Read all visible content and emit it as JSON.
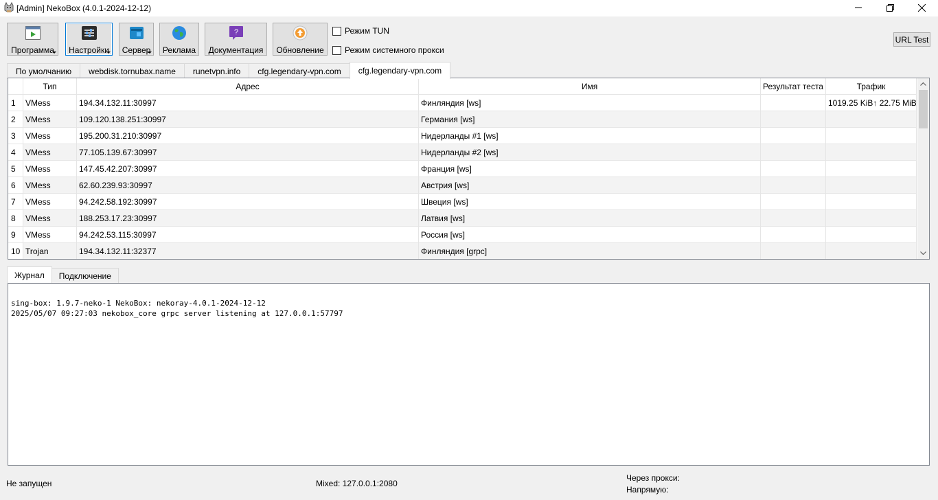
{
  "window": {
    "title": "[Admin] NekoBox (4.0.1-2024-12-12)"
  },
  "toolbar": {
    "buttons": [
      {
        "label": "Программа",
        "icon": "program-icon"
      },
      {
        "label": "Настройки",
        "icon": "settings-sliders-icon"
      },
      {
        "label": "Сервер",
        "icon": "server-icon"
      },
      {
        "label": "Реклама",
        "icon": "globe-icon"
      },
      {
        "label": "Документация",
        "icon": "help-doc-icon"
      },
      {
        "label": "Обновление",
        "icon": "update-icon"
      }
    ],
    "tun_mode": {
      "label": "Режим TUN",
      "checked": false
    },
    "system_proxy": {
      "label": "Режим системного прокси",
      "checked": false
    },
    "url_test": "URL Test"
  },
  "groups": {
    "tabs": [
      "По умолчанию",
      "webdisk.tornubax.name",
      "runetvpn.info",
      "cfg.legendary-vpn.com",
      "cfg.legendary-vpn.com"
    ],
    "active_index": 4
  },
  "table": {
    "headers": [
      "Тип",
      "Адрес",
      "Имя",
      "Результат теста",
      "Трафик"
    ],
    "rows": [
      {
        "n": "1",
        "type": "VMess",
        "address": "194.34.132.11:30997",
        "name": "Финляндия [ws]",
        "result": "",
        "traffic": "1019.25 KiB↑ 22.75 MiB↓"
      },
      {
        "n": "2",
        "type": "VMess",
        "address": "109.120.138.251:30997",
        "name": "Германия [ws]",
        "result": "",
        "traffic": ""
      },
      {
        "n": "3",
        "type": "VMess",
        "address": "195.200.31.210:30997",
        "name": "Нидерланды #1 [ws]",
        "result": "",
        "traffic": ""
      },
      {
        "n": "4",
        "type": "VMess",
        "address": "77.105.139.67:30997",
        "name": "Нидерланды #2 [ws]",
        "result": "",
        "traffic": ""
      },
      {
        "n": "5",
        "type": "VMess",
        "address": "147.45.42.207:30997",
        "name": "Франция [ws]",
        "result": "",
        "traffic": ""
      },
      {
        "n": "6",
        "type": "VMess",
        "address": "62.60.239.93:30997",
        "name": "Австрия [ws]",
        "result": "",
        "traffic": ""
      },
      {
        "n": "7",
        "type": "VMess",
        "address": "94.242.58.192:30997",
        "name": "Швеция [ws]",
        "result": "",
        "traffic": ""
      },
      {
        "n": "8",
        "type": "VMess",
        "address": "188.253.17.23:30997",
        "name": "Латвия [ws]",
        "result": "",
        "traffic": ""
      },
      {
        "n": "9",
        "type": "VMess",
        "address": "94.242.53.115:30997",
        "name": "Россия [ws]",
        "result": "",
        "traffic": ""
      },
      {
        "n": "10",
        "type": "Trojan",
        "address": "194.34.132.11:32377",
        "name": "Финляндия [grpc]",
        "result": "",
        "traffic": ""
      }
    ]
  },
  "bottom_tabs": {
    "tabs": [
      "Журнал",
      "Подключение"
    ],
    "active_index": 0
  },
  "log": {
    "lines": [
      "sing-box: 1.9.7-neko-1 NekoBox: nekoray-4.0.1-2024-12-12",
      "2025/05/07 09:27:03 nekobox_core grpc server listening at 127.0.0.1:57797"
    ]
  },
  "status": {
    "state": "Не запущен",
    "mixed": "Mixed: 127.0.0.1:2080",
    "via_proxy": "Через прокси:",
    "direct": "Напрямую:"
  }
}
